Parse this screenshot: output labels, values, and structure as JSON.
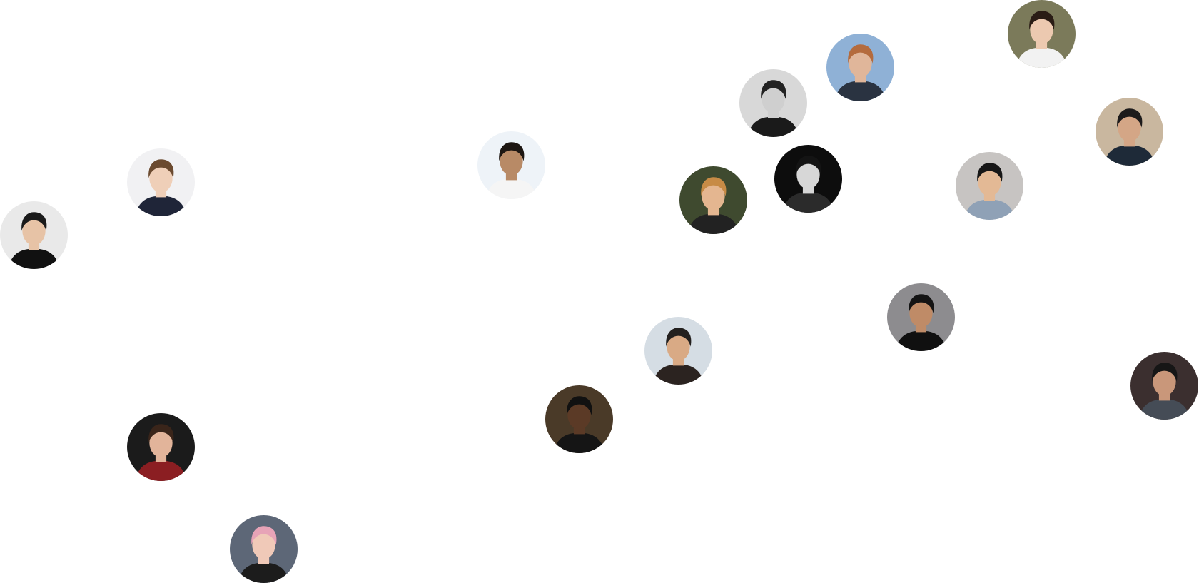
{
  "avatars": [
    {
      "id": "avatar-man-hat-glasses",
      "bg": "#e9e9e9",
      "skin": "#e7c3a6",
      "hair": "#1a1a1a",
      "shirt": "#111111"
    },
    {
      "id": "avatar-man-suit",
      "bg": "#f1f1f3",
      "skin": "#efcfb8",
      "hair": "#6b4a2f",
      "shirt": "#1f2538"
    },
    {
      "id": "avatar-man-white-shirt",
      "bg": "#eef3f8",
      "skin": "#b88a66",
      "hair": "#1d1612",
      "shirt": "#f5f5f5"
    },
    {
      "id": "avatar-man-bw",
      "bg": "#d8d8d8",
      "skin": "#cfcfcf",
      "hair": "#222222",
      "shirt": "#1a1a1a"
    },
    {
      "id": "avatar-man-sunglasses",
      "bg": "#8fb1d6",
      "skin": "#e0b69a",
      "hair": "#b46b3d",
      "shirt": "#2a3341"
    },
    {
      "id": "avatar-woman-field",
      "bg": "#7b7a5a",
      "skin": "#ecc9b0",
      "hair": "#2a1c15",
      "shirt": "#f2f2f2"
    },
    {
      "id": "avatar-man-sunset",
      "bg": "#c9b79f",
      "skin": "#d4a686",
      "hair": "#1d1b1b",
      "shirt": "#1e2a38"
    },
    {
      "id": "avatar-woman-flowers",
      "bg": "#3f4a2f",
      "skin": "#e4b690",
      "hair": "#c78b46",
      "shirt": "#222222"
    },
    {
      "id": "avatar-man-bw-dark",
      "bg": "#0d0d0d",
      "skin": "#d7d7d7",
      "hair": "#141414",
      "shirt": "#2b2b2b"
    },
    {
      "id": "avatar-man-glasses-neutral",
      "bg": "#c7c4c2",
      "skin": "#e3b995",
      "hair": "#171717",
      "shirt": "#8fa1b6"
    },
    {
      "id": "avatar-man-city-view",
      "bg": "#8d8c8f",
      "skin": "#bf8b67",
      "hair": "#141414",
      "shirt": "#101010"
    },
    {
      "id": "avatar-man-window",
      "bg": "#d5dde4",
      "skin": "#d9aa85",
      "hair": "#23201e",
      "shirt": "#2b2320"
    },
    {
      "id": "avatar-man-dark-shirt",
      "bg": "#3b2f2f",
      "skin": "#c9977a",
      "hair": "#161616",
      "shirt": "#454c56"
    },
    {
      "id": "avatar-man-restaurant",
      "bg": "#4a3a28",
      "skin": "#5b3a26",
      "hair": "#111111",
      "shirt": "#151515"
    },
    {
      "id": "avatar-woman-curly",
      "bg": "#1b1b1b",
      "skin": "#e2b49a",
      "hair": "#3a251a",
      "shirt": "#8b1e22"
    },
    {
      "id": "avatar-woman-pink-hair",
      "bg": "#5d6777",
      "skin": "#f0c9b8",
      "hair": "#e7a3b7",
      "shirt": "#1c1c1c"
    }
  ]
}
